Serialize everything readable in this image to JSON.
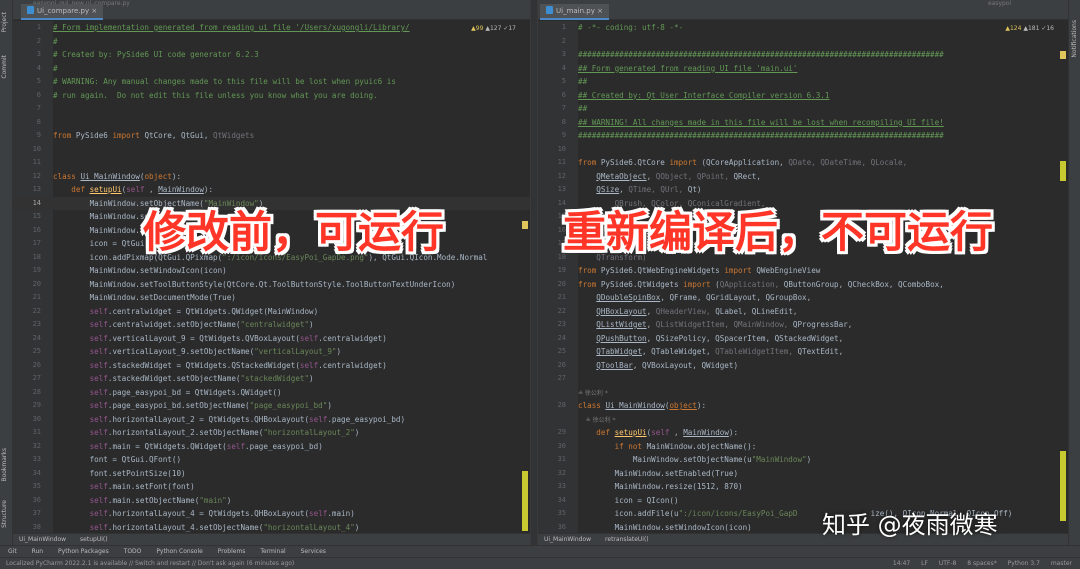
{
  "left_tab": {
    "label": "Ui_compare.py"
  },
  "left_top_path": "easypoi_gui_new    ui_compare.py",
  "right_tab": {
    "label": "Ui_main.py"
  },
  "right_top_path": "easypoi",
  "left_inspect": {
    "warn": "▲99",
    "weak": "▲127",
    "typo": "✓17"
  },
  "right_inspect": {
    "warn": "▲124",
    "weak": "▲181",
    "typo": "✓16"
  },
  "side_tabs": [
    "Project",
    "Commit",
    "Bookmarks",
    "Structure"
  ],
  "right_side_tab": "Notifications",
  "left_breadcrumb": [
    "Ui_MainWindow",
    "setupUi()"
  ],
  "right_breadcrumb": [
    "Ui_MainWindow",
    "retranslateUi()"
  ],
  "tool_windows": [
    "Git",
    "Run",
    "Python Packages",
    "TODO",
    "Python Console",
    "Problems",
    "Terminal",
    "Services"
  ],
  "status": {
    "message": "Localized PyCharm 2022.2.1 is available // Switch and restart // Don't ask again (6 minutes ago)",
    "position": "14:47",
    "line_sep": "LF",
    "encoding": "UTF-8",
    "indent": "8 spaces*",
    "interpreter": "Python 3.7",
    "branch": "master"
  },
  "left_lines": [
    {
      "n": "1",
      "s": [
        [
          "cmt ul",
          "# Form implementation generated from reading ui file '/Users/xugongli/Library/"
        ]
      ]
    },
    {
      "n": "2",
      "s": [
        [
          "cmt",
          "#"
        ]
      ]
    },
    {
      "n": "3",
      "s": [
        [
          "cmt",
          "# Created by: PySide6 UI code generator 6.2.3"
        ]
      ]
    },
    {
      "n": "4",
      "s": [
        [
          "cmt",
          "#"
        ]
      ]
    },
    {
      "n": "5",
      "s": [
        [
          "cmt",
          "# WARNING: Any manual changes made to this file will be lost when pyuic6 is"
        ]
      ]
    },
    {
      "n": "6",
      "s": [
        [
          "cmt",
          "# run again.  Do not edit this file unless you know what you are doing."
        ]
      ]
    },
    {
      "n": "7",
      "s": [
        [
          "",
          ""
        ]
      ]
    },
    {
      "n": "8",
      "s": [
        [
          "",
          ""
        ]
      ]
    },
    {
      "n": "9",
      "s": [
        [
          "kw",
          "from "
        ],
        [
          "",
          "PySide6 "
        ],
        [
          "kw",
          "import "
        ],
        [
          "",
          "QtCore, QtGui, "
        ],
        [
          "dim",
          "QtWidgets"
        ]
      ]
    },
    {
      "n": "10",
      "s": [
        [
          "",
          ""
        ]
      ]
    },
    {
      "n": "11",
      "s": [
        [
          "",
          ""
        ]
      ]
    },
    {
      "n": "12",
      "s": [
        [
          "kw",
          "class "
        ],
        [
          "ul",
          "Ui_MainWindow"
        ],
        [
          "",
          "("
        ],
        [
          "kw",
          "object"
        ],
        [
          "",
          "):"
        ]
      ]
    },
    {
      "n": "13",
      "s": [
        [
          "",
          "    "
        ],
        [
          "kw",
          "def "
        ],
        [
          "fn ul",
          "setupUi"
        ],
        [
          "",
          "("
        ],
        [
          "slf",
          "self"
        ],
        [
          "",
          " , "
        ],
        [
          "ul",
          "MainWindow"
        ],
        [
          "",
          "):"
        ]
      ]
    },
    {
      "n": "14",
      "cur": true,
      "s": [
        [
          "",
          "        MainWindow.setObjectName("
        ],
        [
          "str",
          "\"MainWindow\""
        ],
        [
          "",
          ")"
        ]
      ]
    },
    {
      "n": "15",
      "s": [
        [
          "",
          "        MainWindow.setEnabled(True)"
        ]
      ]
    },
    {
      "n": "16",
      "s": [
        [
          "",
          "        MainWindow.resize(1512, 870)"
        ]
      ]
    },
    {
      "n": "17",
      "s": [
        [
          "",
          "        icon = QtGui.QIcon()"
        ]
      ]
    },
    {
      "n": "18",
      "s": [
        [
          "",
          "        icon.addPixmap(QtGui.QPixmap("
        ],
        [
          "str",
          "\":/icon/icons/EasyPoi_GapDe.png\""
        ],
        [
          "",
          "), QtGui.QIcon.Mode.Normal"
        ]
      ]
    },
    {
      "n": "19",
      "s": [
        [
          "",
          "        MainWindow.setWindowIcon(icon)"
        ]
      ]
    },
    {
      "n": "20",
      "s": [
        [
          "",
          "        MainWindow.setToolButtonStyle(QtCore.Qt.ToolButtonStyle.ToolButtonTextUnderIcon)"
        ]
      ]
    },
    {
      "n": "21",
      "s": [
        [
          "",
          "        MainWindow.setDocumentMode(True)"
        ]
      ]
    },
    {
      "n": "22",
      "s": [
        [
          "",
          "        "
        ],
        [
          "slf",
          "self"
        ],
        [
          "",
          ".centralwidget = QtWidgets.QWidget(MainWindow)"
        ]
      ]
    },
    {
      "n": "23",
      "s": [
        [
          "",
          "        "
        ],
        [
          "slf",
          "self"
        ],
        [
          "",
          ".centralwidget.setObjectName("
        ],
        [
          "str",
          "\"centralwidget\""
        ],
        [
          "",
          ")"
        ]
      ]
    },
    {
      "n": "24",
      "s": [
        [
          "",
          "        "
        ],
        [
          "slf",
          "self"
        ],
        [
          "",
          ".verticalLayout_9 = QtWidgets.QVBoxLayout("
        ],
        [
          "slf",
          "self"
        ],
        [
          "",
          ".centralwidget)"
        ]
      ]
    },
    {
      "n": "25",
      "s": [
        [
          "",
          "        "
        ],
        [
          "slf",
          "self"
        ],
        [
          "",
          ".verticalLayout_9.setObjectName("
        ],
        [
          "str",
          "\"verticalLayout_9\""
        ],
        [
          "",
          ")"
        ]
      ]
    },
    {
      "n": "26",
      "s": [
        [
          "",
          "        "
        ],
        [
          "slf",
          "self"
        ],
        [
          "",
          ".stackedWidget = QtWidgets.QStackedWidget("
        ],
        [
          "slf",
          "self"
        ],
        [
          "",
          ".centralwidget)"
        ]
      ]
    },
    {
      "n": "27",
      "s": [
        [
          "",
          "        "
        ],
        [
          "slf",
          "self"
        ],
        [
          "",
          ".stackedWidget.setObjectName("
        ],
        [
          "str",
          "\"stackedWidget\""
        ],
        [
          "",
          ")"
        ]
      ]
    },
    {
      "n": "28",
      "s": [
        [
          "",
          "        "
        ],
        [
          "slf",
          "self"
        ],
        [
          "",
          ".page_easypoi_bd = QtWidgets.QWidget()"
        ]
      ]
    },
    {
      "n": "29",
      "s": [
        [
          "",
          "        "
        ],
        [
          "slf",
          "self"
        ],
        [
          "",
          ".page_easypoi_bd.setObjectName("
        ],
        [
          "str",
          "\"page_easypoi_bd\""
        ],
        [
          "",
          ")"
        ]
      ]
    },
    {
      "n": "30",
      "s": [
        [
          "",
          "        "
        ],
        [
          "slf",
          "self"
        ],
        [
          "",
          ".horizontalLayout_2 = QtWidgets.QHBoxLayout("
        ],
        [
          "slf",
          "self"
        ],
        [
          "",
          ".page_easypoi_bd)"
        ]
      ]
    },
    {
      "n": "31",
      "s": [
        [
          "",
          "        "
        ],
        [
          "slf",
          "self"
        ],
        [
          "",
          ".horizontalLayout_2.setObjectName("
        ],
        [
          "str",
          "\"horizontalLayout_2\""
        ],
        [
          "",
          ")"
        ]
      ]
    },
    {
      "n": "32",
      "s": [
        [
          "",
          "        "
        ],
        [
          "slf",
          "self"
        ],
        [
          "",
          ".main = QtWidgets.QWidget("
        ],
        [
          "slf",
          "self"
        ],
        [
          "",
          ".page_easypoi_bd)"
        ]
      ]
    },
    {
      "n": "33",
      "s": [
        [
          "",
          "        font = QtGui.QFont()"
        ]
      ]
    },
    {
      "n": "34",
      "s": [
        [
          "",
          "        font.setPointSize(10)"
        ]
      ]
    },
    {
      "n": "35",
      "s": [
        [
          "",
          "        "
        ],
        [
          "slf",
          "self"
        ],
        [
          "",
          ".main.setFont(font)"
        ]
      ]
    },
    {
      "n": "36",
      "s": [
        [
          "",
          "        "
        ],
        [
          "slf",
          "self"
        ],
        [
          "",
          ".main.setObjectName("
        ],
        [
          "str",
          "\"main\""
        ],
        [
          "",
          ")"
        ]
      ]
    },
    {
      "n": "37",
      "s": [
        [
          "",
          "        "
        ],
        [
          "slf",
          "self"
        ],
        [
          "",
          ".horizontalLayout_4 = QtWidgets.QHBoxLayout("
        ],
        [
          "slf",
          "self"
        ],
        [
          "",
          ".main)"
        ]
      ]
    },
    {
      "n": "38",
      "s": [
        [
          "",
          "        "
        ],
        [
          "slf",
          "self"
        ],
        [
          "",
          ".horizontalLayout_4.setObjectName("
        ],
        [
          "str",
          "\"horizontalLayout_4\""
        ],
        [
          "",
          ")"
        ]
      ]
    }
  ],
  "right_lines": [
    {
      "n": "1",
      "s": [
        [
          "cmt",
          "# -*- coding: utf-8 -*-"
        ]
      ]
    },
    {
      "n": "2",
      "s": [
        [
          "",
          ""
        ]
      ]
    },
    {
      "n": "3",
      "s": [
        [
          "cmt",
          "################################################################################"
        ]
      ]
    },
    {
      "n": "4",
      "s": [
        [
          "cmt ul",
          "## Form generated from reading UI file 'main.ui'"
        ]
      ]
    },
    {
      "n": "5",
      "s": [
        [
          "cmt",
          "##"
        ]
      ]
    },
    {
      "n": "6",
      "s": [
        [
          "cmt ul",
          "## Created by: Qt User Interface Compiler version 6.3.1"
        ]
      ]
    },
    {
      "n": "7",
      "s": [
        [
          "cmt",
          "##"
        ]
      ]
    },
    {
      "n": "8",
      "s": [
        [
          "cmt ul",
          "## WARNING! All changes made in this file will be lost when recompiling UI file!"
        ]
      ]
    },
    {
      "n": "9",
      "s": [
        [
          "cmt",
          "################################################################################"
        ]
      ]
    },
    {
      "n": "10",
      "s": [
        [
          "",
          ""
        ]
      ]
    },
    {
      "n": "11",
      "s": [
        [
          "kw",
          "from "
        ],
        [
          "",
          "PySide6.QtCore "
        ],
        [
          "kw",
          "import "
        ],
        [
          "",
          "(QCoreApplication, "
        ],
        [
          "dim",
          "QDate, QDateTime, QLocale,"
        ]
      ]
    },
    {
      "n": "12",
      "s": [
        [
          "",
          "    "
        ],
        [
          "ul",
          "QMetaObject"
        ],
        [
          "",
          ", "
        ],
        [
          "dim",
          "QObject, QPoint, "
        ],
        [
          "",
          "QRect,"
        ]
      ]
    },
    {
      "n": "13",
      "s": [
        [
          "",
          "    "
        ],
        [
          "ul",
          "QSize"
        ],
        [
          "",
          ", "
        ],
        [
          "dim",
          "QTime, QUrl, "
        ],
        [
          "",
          "Qt)"
        ]
      ]
    },
    {
      "n": "14",
      "s": [
        [
          "",
          "    "
        ],
        [
          "dim",
          "    QBrush, QColor, QConicalGradient,"
        ]
      ]
    },
    {
      "n": "15",
      "s": [
        [
          "",
          ""
        ]
      ]
    },
    {
      "n": "16",
      "s": [
        [
          "",
          ""
        ]
      ]
    },
    {
      "n": "17",
      "s": [
        [
          "",
          "    "
        ],
        [
          "dim",
          "    QPixmap, QRadialGradient,"
        ]
      ]
    },
    {
      "n": "18",
      "s": [
        [
          "",
          "    "
        ],
        [
          "dim",
          "QTransform)"
        ]
      ]
    },
    {
      "n": "19",
      "s": [
        [
          "kw",
          "from "
        ],
        [
          "",
          "PySide6.QtWebEngineWidgets "
        ],
        [
          "kw",
          "import "
        ],
        [
          "",
          "QWebEngineView"
        ]
      ]
    },
    {
      "n": "20",
      "s": [
        [
          "kw",
          "from "
        ],
        [
          "",
          "PySide6.QtWidgets "
        ],
        [
          "kw",
          "import "
        ],
        [
          "",
          "("
        ],
        [
          "dim",
          "QApplication, "
        ],
        [
          "",
          "QButtonGroup, QCheckBox, QComboBox,"
        ]
      ]
    },
    {
      "n": "21",
      "s": [
        [
          "",
          "    "
        ],
        [
          "ul",
          "QDoubleSpinBox"
        ],
        [
          "",
          ", QFrame, QGridLayout, QGroupBox,"
        ]
      ]
    },
    {
      "n": "22",
      "s": [
        [
          "",
          "    "
        ],
        [
          "ul",
          "QHBoxLayout"
        ],
        [
          "",
          ", "
        ],
        [
          "dim",
          "QHeaderView, "
        ],
        [
          "",
          "QLabel, QLineEdit,"
        ]
      ]
    },
    {
      "n": "23",
      "s": [
        [
          "",
          "    "
        ],
        [
          "ul",
          "QListWidget"
        ],
        [
          "",
          ", "
        ],
        [
          "dim",
          "QListWidgetItem, QMainWindow, "
        ],
        [
          "",
          "QProgressBar,"
        ]
      ]
    },
    {
      "n": "24",
      "s": [
        [
          "",
          "    "
        ],
        [
          "ul",
          "QPushButton"
        ],
        [
          "",
          ", QSizePolicy, QSpacerItem, QStackedWidget,"
        ]
      ]
    },
    {
      "n": "25",
      "s": [
        [
          "",
          "    "
        ],
        [
          "ul",
          "QTabWidget"
        ],
        [
          "",
          ", QTableWidget, "
        ],
        [
          "dim",
          "QTableWidgetItem, "
        ],
        [
          "",
          "QTextEdit,"
        ]
      ]
    },
    {
      "n": "26",
      "s": [
        [
          "",
          "    "
        ],
        [
          "ul",
          "QToolBar"
        ],
        [
          "",
          ", QVBoxLayout, QWidget)"
        ]
      ]
    },
    {
      "n": "27",
      "s": [
        [
          "",
          ""
        ]
      ]
    },
    {
      "n": "",
      "hint": "≗ 徐公利 *"
    },
    {
      "n": "28",
      "s": [
        [
          "kw",
          "class "
        ],
        [
          "ul",
          "Ui_MainWindow"
        ],
        [
          "",
          "("
        ],
        [
          "kw ul",
          "object"
        ],
        [
          "",
          "):"
        ]
      ]
    },
    {
      "n": "",
      "hint": "    ≗ 徐公利 *"
    },
    {
      "n": "29",
      "s": [
        [
          "",
          "    "
        ],
        [
          "kw",
          "def "
        ],
        [
          "fn ul",
          "setupUi"
        ],
        [
          "",
          "("
        ],
        [
          "slf",
          "self"
        ],
        [
          "",
          " , "
        ],
        [
          "ul",
          "MainWindow"
        ],
        [
          "",
          "):"
        ]
      ]
    },
    {
      "n": "30",
      "s": [
        [
          "",
          "        "
        ],
        [
          "kw",
          "if not "
        ],
        [
          "",
          "MainWindow.objectName():"
        ]
      ]
    },
    {
      "n": "31",
      "s": [
        [
          "",
          "            MainWindow.setObjectName(u"
        ],
        [
          "str",
          "\"MainWindow\""
        ],
        [
          "",
          ")"
        ]
      ]
    },
    {
      "n": "32",
      "s": [
        [
          "",
          "        MainWindow.setEnabled(True)"
        ]
      ]
    },
    {
      "n": "33",
      "s": [
        [
          "",
          "        MainWindow.resize(1512, 870)"
        ]
      ]
    },
    {
      "n": "34",
      "s": [
        [
          "",
          "        icon = QIcon()"
        ]
      ]
    },
    {
      "n": "35",
      "s": [
        [
          "",
          "        icon.addFile(u"
        ],
        [
          "str",
          "\":/icon/icons/EasyPoi_GapD"
        ],
        [
          "",
          "                ize(), QIcon.Normal, QIcon.Off)"
        ]
      ]
    },
    {
      "n": "36",
      "s": [
        [
          "",
          "        MainWindow.setWindowIcon(icon)"
        ]
      ]
    }
  ],
  "overlay_left": "修改前，可运行",
  "overlay_right": "重新编译后，不可运行",
  "watermark": "知乎 @夜雨微寒"
}
